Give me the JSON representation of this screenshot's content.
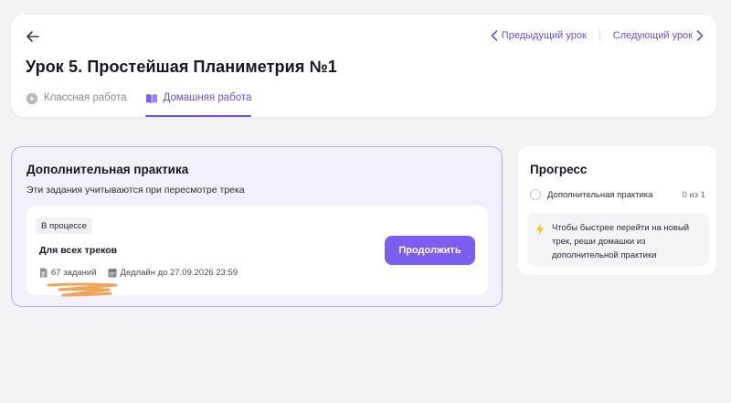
{
  "header": {
    "lesson_title": "Урок 5. Простейшая Планиметрия №1",
    "prev_lesson": "Предыдущий урок",
    "next_lesson": "Следующий урок",
    "tabs": [
      {
        "label": "Классная работа",
        "icon": "play-circle-icon",
        "active": false
      },
      {
        "label": "Домашняя работа",
        "icon": "book-icon",
        "active": true
      }
    ]
  },
  "practice": {
    "title": "Дополнительная практика",
    "subtitle": "Эти задания учитываются при пересмотре трека",
    "track": {
      "status": "В процессе",
      "name": "Для всех треков",
      "tasks": "67 заданий",
      "deadline": "Дедлайн до 27.09.2026 23:59",
      "button": "Продолжить"
    }
  },
  "progress": {
    "title": "Прогресс",
    "items": [
      {
        "label": "Дополнительная практика",
        "count": "0 из 1"
      }
    ],
    "hint": "Чтобы быстрее перейти на новый трек, реши домашки из дополнительной практики"
  },
  "colors": {
    "accent": "#7c5ef0",
    "accent_text": "#6b4fd6",
    "card_border": "#b7aae6",
    "highlight_scribble": "#f0a45a",
    "lightning": "#f5c518"
  }
}
